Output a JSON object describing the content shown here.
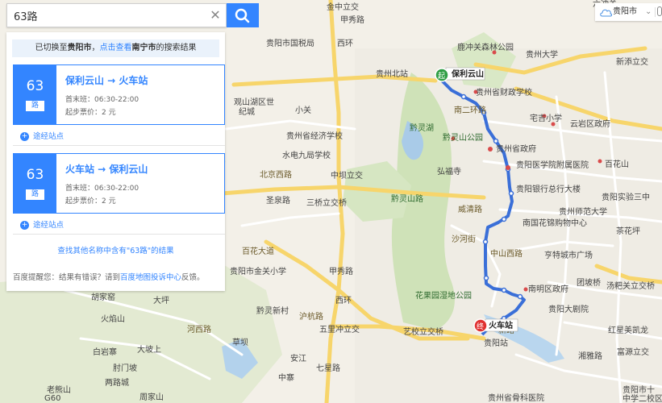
{
  "search": {
    "value": "63路"
  },
  "panel": {
    "notice": {
      "prefix": "已切换至",
      "city": "贵阳市",
      "comma": "，",
      "link": "点击查看",
      "other_city": "南宁市",
      "suffix": "的搜索结果"
    },
    "results": [
      {
        "number": "63",
        "unit": "路",
        "route": "保利云山 → 火车站",
        "first_bus": "首末班：06:30-22:00",
        "fare": "起步票价：2 元",
        "stops": "途经站点"
      },
      {
        "number": "63",
        "unit": "路",
        "route": "火车站 → 保利云山",
        "first_bus": "首末班：06:30-22:00",
        "fare": "起步票价：2 元",
        "stops": "途经站点"
      }
    ],
    "more": "查找其他名称中含有\"63路\"的结果",
    "feedback": {
      "prefix": "百度提醒您：结果有错误？请到",
      "link": "百度地图投诉中心",
      "suffix": "反馈。"
    }
  },
  "city": {
    "name": "贵阳市"
  },
  "map": {
    "start_label": "保利云山",
    "start_marker": "起",
    "end_label": "火车站",
    "end_marker": "终",
    "labels": {
      "a1": "金中立交",
      "a2": "甲秀路",
      "a3": "六冲关",
      "a4": "鹿冲关森林公园",
      "a5": "贵州大学",
      "a6": "新添立交",
      "a7": "贵州北站",
      "a8": "贵阳市国税局",
      "a9": "西环",
      "a10": "贵州省财政学校",
      "a11": "宅吉小学",
      "a12": "云岩区政府",
      "a13": "观山湖区世",
      "a14": "纪城",
      "a15": "贵州省经济学校",
      "a16": "黔灵山公园",
      "a17": "贵州省政府",
      "a18": "贵阳医学院附属医院",
      "a19": "水电九局学校",
      "a20": "中坝立交",
      "a21": "弘福寺",
      "a22": "贵阳银行总行大楼",
      "a23": "百花山",
      "a24": "北京西路",
      "a25": "三桥立交桥",
      "a26": "黔灵山路",
      "a27": "威清路",
      "a28": "贵州师范大学",
      "a29": "贵阳实验三中",
      "a30": "南国花锦购物中心",
      "a31": "茶花坪",
      "a32": "百花大道",
      "a33": "贵阳市金关小学",
      "a34": "中山西路",
      "a35": "亨特城市广场",
      "a36": "汤粑关立交桥",
      "a37": "黔灵新村",
      "a38": "花果园湿地公园",
      "a39": "南明区政府",
      "a40": "团坡桥",
      "a41": "贵阳大剧院",
      "a42": "五里冲立交",
      "a43": "艺校立交桥",
      "a44": "新路",
      "a45": "红星美凯龙",
      "a46": "富源立交",
      "a47": "胡家窑",
      "a48": "大坪",
      "a49": "火焰山",
      "a50": "河西路",
      "a51": "白岩寨",
      "a52": "大坡上",
      "a53": "草坝",
      "a54": "肘门坡",
      "a55": "两路城",
      "a56": "老熊山",
      "a57": "周家山",
      "a58": "贵州省骨科医院",
      "a59": "贵阳市十",
      "a60": "中学二校区",
      "a61": "沪杭路",
      "a62": "安江",
      "a63": "西环",
      "a64": "小关",
      "a65": "圣泉路",
      "a66": "中寨",
      "a67": "七星路",
      "a68": "甲秀路",
      "a69": "贵阳站",
      "a70": "湘雅路",
      "a71": "G60",
      "a72": "南二环路",
      "a73": "黔灵湖",
      "a74": "沙河街"
    }
  }
}
